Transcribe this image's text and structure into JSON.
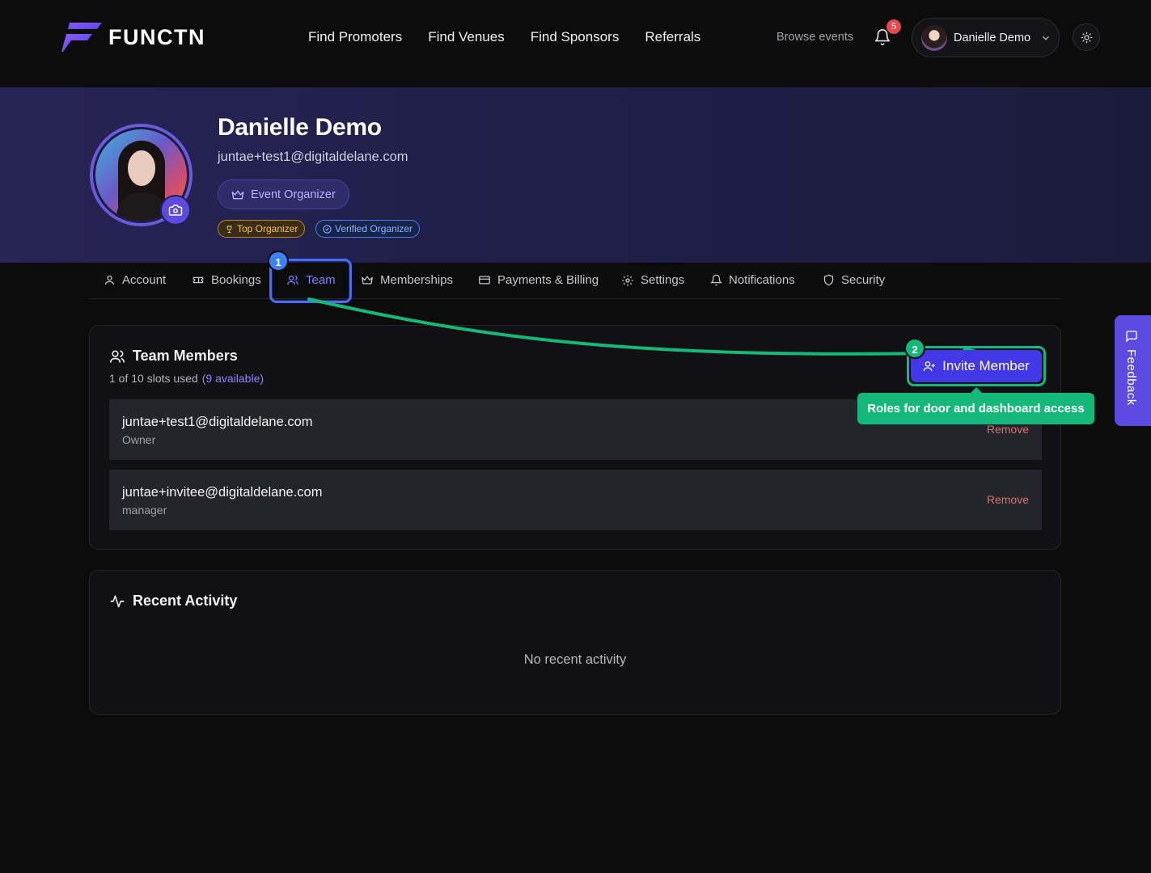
{
  "brand": {
    "name": "FUNCTN"
  },
  "nav": {
    "items": [
      "Find Promoters",
      "Find Venues",
      "Find Sponsors",
      "Referrals"
    ],
    "browse": "Browse events",
    "notification_count": "5",
    "user_name": "Danielle Demo"
  },
  "profile": {
    "name": "Danielle Demo",
    "email": "juntae+test1@digitaldelane.com",
    "role": "Event Organizer",
    "badges": [
      "Top Organizer",
      "Verified Organizer"
    ]
  },
  "tabs": [
    {
      "label": "Account",
      "icon": "user-icon"
    },
    {
      "label": "Bookings",
      "icon": "ticket-icon"
    },
    {
      "label": "Team",
      "icon": "users-icon",
      "active": true
    },
    {
      "label": "Memberships",
      "icon": "crown-icon"
    },
    {
      "label": "Payments & Billing",
      "icon": "credit-card-icon"
    },
    {
      "label": "Settings",
      "icon": "gear-icon"
    },
    {
      "label": "Notifications",
      "icon": "bell-icon"
    },
    {
      "label": "Security",
      "icon": "shield-icon"
    }
  ],
  "team": {
    "title": "Team Members",
    "slots": "1 of 10 slots used",
    "available": "(9 available)",
    "invite_label": "Invite Member",
    "members": [
      {
        "email": "juntae+test1@digitaldelane.com",
        "role": "Owner",
        "action": "Remove"
      },
      {
        "email": "juntae+invitee@digitaldelane.com",
        "role": "manager",
        "action": "Remove"
      }
    ]
  },
  "activity": {
    "title": "Recent Activity",
    "empty": "No recent activity"
  },
  "annotations": {
    "step1": "1",
    "step2": "2",
    "tooltip": "Roles for door and dashboard access"
  },
  "feedback": {
    "label": "Feedback"
  },
  "colors": {
    "accent": "#5b4be0",
    "annotation_green": "#14b87a",
    "annotation_blue": "#3b82f6",
    "remove": "#e06c6c"
  }
}
